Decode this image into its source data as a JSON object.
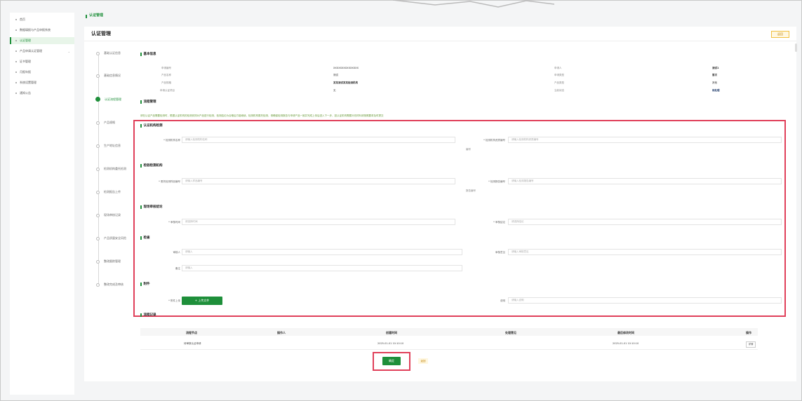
{
  "sidebar": {
    "items": [
      {
        "label": "首页"
      },
      {
        "label": "数据填报与产品申报系统"
      },
      {
        "label": "认证管理"
      },
      {
        "label": "产品申请认证管理"
      },
      {
        "label": "证书管理"
      },
      {
        "label": "月报年报"
      },
      {
        "label": "系统设置管理"
      },
      {
        "label": "通知公告"
      }
    ]
  },
  "header": {
    "breadcrumb": "认证管理",
    "title": "认证管理",
    "tag": "返回"
  },
  "steps": [
    {
      "label": "基础认证信息"
    },
    {
      "label": "基础信息情况"
    },
    {
      "label": "认证流程管理"
    },
    {
      "label": "产品规格"
    },
    {
      "label": "生产地址信息"
    },
    {
      "label": "检测机构委托检测"
    },
    {
      "label": "检测报告上传"
    },
    {
      "label": "现场审核记录"
    },
    {
      "label": "产品质量安全风险"
    },
    {
      "label": "整改跟踪管理"
    },
    {
      "label": "整改完成及审核"
    }
  ],
  "sections": {
    "basic": "基本信息",
    "flow": "流程管理",
    "form1": "认证机构检测",
    "form2": "检验检测机构",
    "form3": "现场审核结论",
    "form4": "检查",
    "form5": "附件",
    "records": "流程记录"
  },
  "info": {
    "row1": {
      "l1": "申请编号",
      "v1": "XXXXXXXXXXXXXXX",
      "l2": "申请人",
      "v2": "测试1"
    },
    "row2": {
      "l1": "产品名称",
      "v1": "测试",
      "l2": "申请类型",
      "v2": "首次"
    },
    "row3": {
      "l1": "产品规格",
      "v1": "某某测试某某检测机构",
      "l2": "产品类型",
      "v2": "其他"
    },
    "row4": {
      "l1": "申请认证项目",
      "v1": "无",
      "l2": "当前状态",
      "v2": "待处理"
    }
  },
  "notice": "请在认证产品需要检测时，根据认证机构的检测安排对产品进行检测，检测结论为合格后方能继续，检测机构委托检测，请确保检测报告与申请产品一致并完成上传后进入下一步，如认证机构需要补充材料请按照要求及时提交",
  "form": {
    "f1": {
      "label": "* 检测机构名称",
      "placeholder": "请输入检测机构名称"
    },
    "f2": {
      "label": "* 检测机构资质编号",
      "placeholder": "请输入检测机构资质编号",
      "note": "编号"
    },
    "f3": {
      "label": "* 委托检测样品编号",
      "placeholder": "请输入样品编号"
    },
    "f4": {
      "label": "* 检测报告编号",
      "placeholder": "请输入检测报告编号",
      "note": "报告编号"
    },
    "f5": {
      "label": "* 审核时间",
      "placeholder": "请选择时间"
    },
    "f6": {
      "label": "* 审核结论",
      "placeholder": "请选择结论"
    },
    "f7": {
      "label": "审核人",
      "placeholder": "请输入"
    },
    "f8": {
      "label": "审核意见",
      "placeholder": "请输入审核意见"
    },
    "f9": {
      "label": "备注",
      "placeholder": "请输入"
    },
    "upload_label": "* 附件上传",
    "upload_button": "+ 上传文件",
    "f10": {
      "label": "说明",
      "placeholder": "请输入说明"
    }
  },
  "table": {
    "headers": [
      "流程节点",
      "操作人",
      "创建时间",
      "处理意见",
      "最后修改时间",
      "操作"
    ],
    "rows": [
      [
        "待审核认证申请",
        "",
        "2025-01-01 10:10:10",
        "",
        "2025-01-01 10:10:10",
        "详情"
      ]
    ]
  },
  "actions": {
    "confirm": "确定",
    "cancel": "返回"
  },
  "colors": {
    "accent": "#1e8f3a",
    "highlight": "#e0405a"
  }
}
